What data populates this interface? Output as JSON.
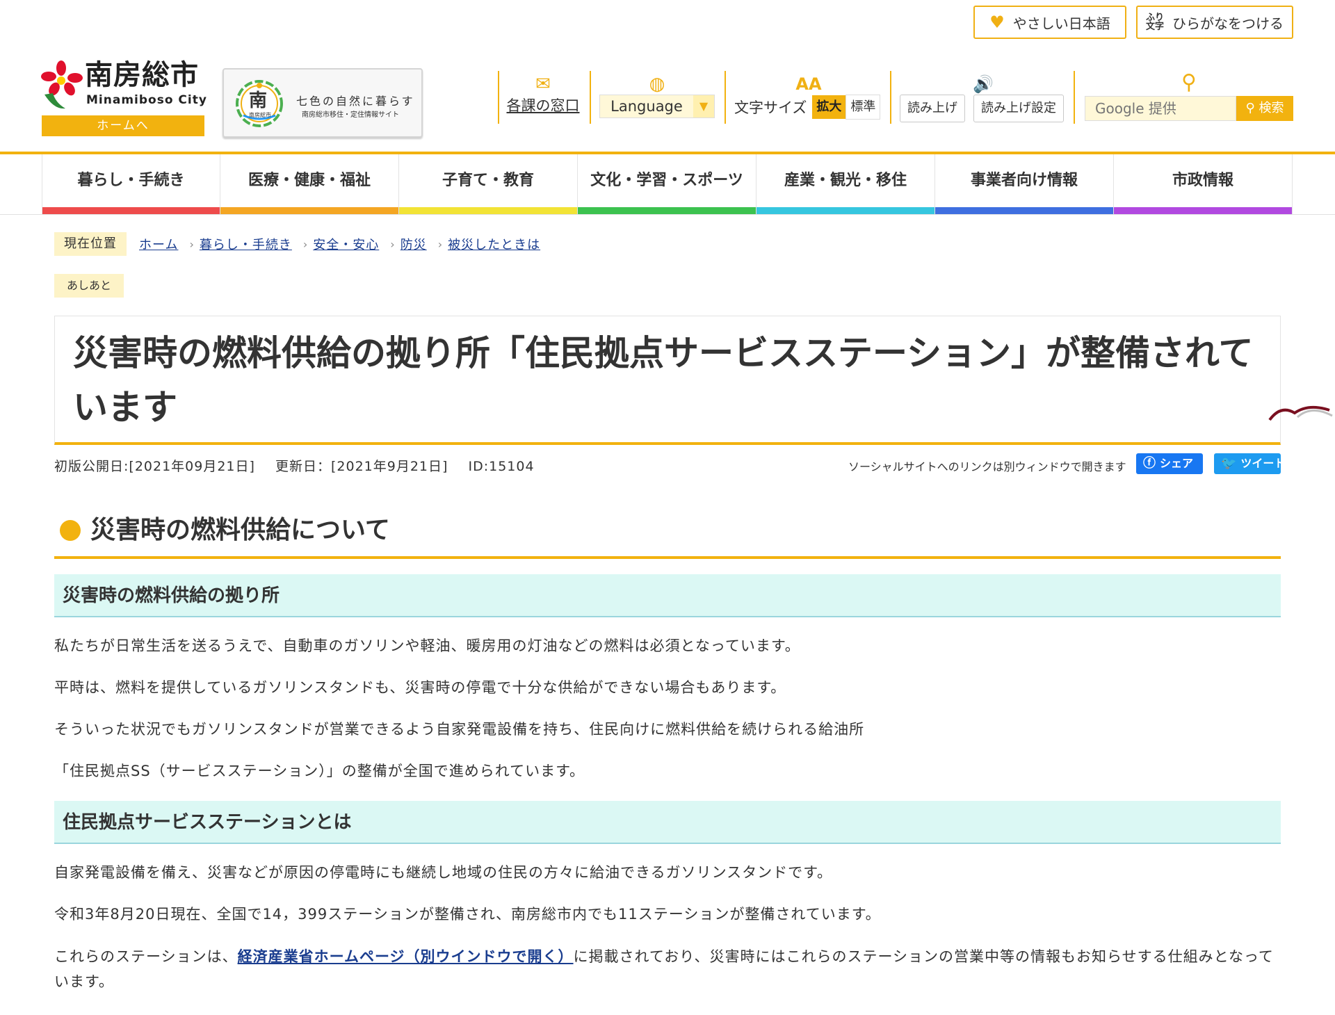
{
  "header": {
    "easy_japanese": "やさしい日本語",
    "hiragana_icon": "ふり\n文字",
    "add_hiragana": "ひらがなをつける",
    "logo_name": "南房総市",
    "logo_roman": "Minamiboso City",
    "home_link": "ホームへ",
    "banner_title": "七色の自然に暮らす",
    "banner_sub": "南房総市移住・定住情報サイト",
    "banner_emblem_char": "南",
    "banner_emblem_sub": "南房総市"
  },
  "utility": {
    "window_label": "各課の窓口",
    "language_label": "Language",
    "font_size_label": "文字サイズ",
    "font_large": "拡大",
    "font_standard": "標準",
    "read_aloud": "読み上げ",
    "read_settings": "読み上げ設定",
    "search_placeholder": "Google 提供",
    "search_button": "検索",
    "font_icon": "AA"
  },
  "nav": {
    "items": [
      {
        "label": "暮らし・手続き",
        "color": "#ee4b4b"
      },
      {
        "label": "医療・健康・福祉",
        "color": "#f4a623"
      },
      {
        "label": "子育て・教育",
        "color": "#f2e335"
      },
      {
        "label": "文化・学習・スポーツ",
        "color": "#3cc24f"
      },
      {
        "label": "産業・観光・移住",
        "color": "#36c6df"
      },
      {
        "label": "事業者向け情報",
        "color": "#3f6fe0"
      },
      {
        "label": "市政情報",
        "color": "#b149e0"
      }
    ]
  },
  "breadcrumb": {
    "label": "現在位置",
    "items": [
      "ホーム",
      "暮らし・手続き",
      "安全・安心",
      "防災",
      "被災したときは"
    ],
    "history_label": "あしあと"
  },
  "article": {
    "title": "災害時の燃料供給の拠り所「住民拠点サービスステーション」が整備されています",
    "published": "初版公開日:[2021年09月21日]",
    "updated": "更新日：[2021年9月21日]",
    "id": "ID:15104",
    "social_note": "ソーシャルサイトへのリンクは別ウィンドウで開きます",
    "share_fb": "シェア",
    "share_tw": "ツイート",
    "h2": "災害時の燃料供給について",
    "h3_1": "災害時の燃料供給の拠り所",
    "p1": "私たちが日常生活を送るうえで、自動車のガソリンや軽油、暖房用の灯油などの燃料は必須となっています。",
    "p2": "平時は、燃料を提供しているガソリンスタンドも、災害時の停電で十分な供給ができない場合もあります。",
    "p3": "そういった状況でもガソリンスタンドが営業できるよう自家発電設備を持ち、住民向けに燃料供給を続けられる給油所",
    "p4": "「住民拠点SS（サービスステーション）」の整備が全国で進められています。",
    "h3_2": "住民拠点サービスステーションとは",
    "p5": "自家発電設備を備え、災害などが原因の停電時にも継続し地域の住民の方々に給油できるガソリンスタンドです。",
    "p6": "令和3年8月20日現在、全国で14，399ステーションが整備され、南房総市内でも11ステーションが整備されています。",
    "p7_before": "これらのステーションは、",
    "p7_link": "経済産業省ホームページ（別ウインドウで開く）",
    "p7_after": "に掲載されており、災害時にはこれらのステーションの営業中等の情報もお知らせする仕組みとなっています。"
  },
  "colors": {
    "accent": "#f2b20f",
    "h3_bg": "#dbf8f4",
    "link": "#1a3d8f"
  },
  "icons": {
    "easy": "heart-icon",
    "hira": "furigana-icon",
    "window": "mail-icon",
    "language": "globe-icon",
    "font": "font-size-icon",
    "read": "speaker-icon",
    "search": "search-icon",
    "facebook": "facebook-icon",
    "twitter": "twitter-icon"
  }
}
